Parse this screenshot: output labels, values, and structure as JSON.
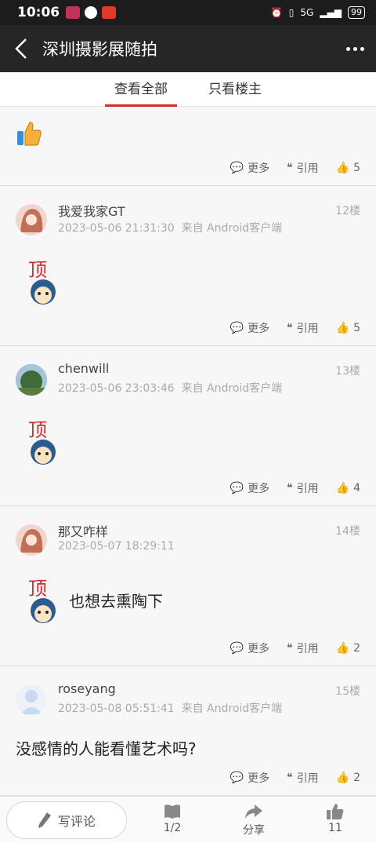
{
  "status_bar": {
    "time": "10:06",
    "battery": "99",
    "signal_label": "5G"
  },
  "header": {
    "title": "深圳摄影展随拍"
  },
  "tabs": [
    {
      "label": "查看全部"
    },
    {
      "label": "只看楼主"
    }
  ],
  "actions": {
    "more": "更多",
    "quote": "引用"
  },
  "posts": [
    {
      "likes": "5"
    },
    {
      "username": "我爱我家GT",
      "time": "2023-05-06 21:31:30",
      "source": "来自 Android客户端",
      "floor": "12楼",
      "likes": "5"
    },
    {
      "username": "chenwill",
      "time": "2023-05-06 23:03:46",
      "source": "来自 Android客户端",
      "floor": "13楼",
      "likes": "4"
    },
    {
      "username": "那又咋样",
      "time": "2023-05-07 18:29:11",
      "source": "",
      "floor": "14楼",
      "text": "也想去熏陶下",
      "likes": "2"
    },
    {
      "username": "roseyang",
      "time": "2023-05-08 05:51:41",
      "source": "来自 Android客户端",
      "floor": "15楼",
      "text": "没感情的人能看懂艺术吗?",
      "likes": "2"
    }
  ],
  "bottom_bar": {
    "comment_label": "写评论",
    "page": "1/2",
    "share": "分享",
    "likes": "11"
  },
  "colors": {
    "accent": "#d0312d",
    "header_bg": "#262626"
  }
}
